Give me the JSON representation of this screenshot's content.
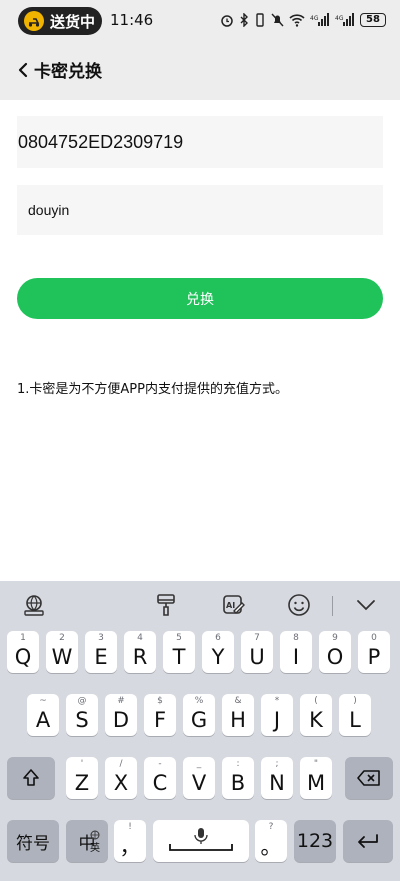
{
  "status": {
    "delivery_label": "送货中",
    "time": "11:46",
    "battery": "58"
  },
  "header": {
    "title": "卡密兑换"
  },
  "form": {
    "card_code": "0804752ED2309719",
    "account": "douyin",
    "redeem_label": "兑换"
  },
  "note": "1.卡密是为不方便APP内支付提供的充值方式。",
  "keyboard": {
    "row1": [
      {
        "key": "Q",
        "hint": "1"
      },
      {
        "key": "W",
        "hint": "2"
      },
      {
        "key": "E",
        "hint": "3"
      },
      {
        "key": "R",
        "hint": "4"
      },
      {
        "key": "T",
        "hint": "5"
      },
      {
        "key": "Y",
        "hint": "6"
      },
      {
        "key": "U",
        "hint": "7"
      },
      {
        "key": "I",
        "hint": "8"
      },
      {
        "key": "O",
        "hint": "9"
      },
      {
        "key": "P",
        "hint": "0"
      }
    ],
    "row2": [
      {
        "key": "A",
        "hint": "~"
      },
      {
        "key": "S",
        "hint": "@"
      },
      {
        "key": "D",
        "hint": "#"
      },
      {
        "key": "F",
        "hint": "$"
      },
      {
        "key": "G",
        "hint": "%"
      },
      {
        "key": "H",
        "hint": "&"
      },
      {
        "key": "J",
        "hint": "*"
      },
      {
        "key": "K",
        "hint": "("
      },
      {
        "key": "L",
        "hint": ")"
      }
    ],
    "row3": [
      {
        "key": "Z",
        "hint": "'"
      },
      {
        "key": "X",
        "hint": "/"
      },
      {
        "key": "C",
        "hint": "-"
      },
      {
        "key": "V",
        "hint": "_"
      },
      {
        "key": "B",
        "hint": ":"
      },
      {
        "key": "N",
        "hint": ";"
      },
      {
        "key": "M",
        "hint": "\""
      }
    ],
    "symbols_label": "符号",
    "chinese_label": "中",
    "english_sub": "英",
    "comma": "，",
    "comma_hint": "!",
    "period": "。",
    "period_hint": "?",
    "numbers_label": "123"
  }
}
